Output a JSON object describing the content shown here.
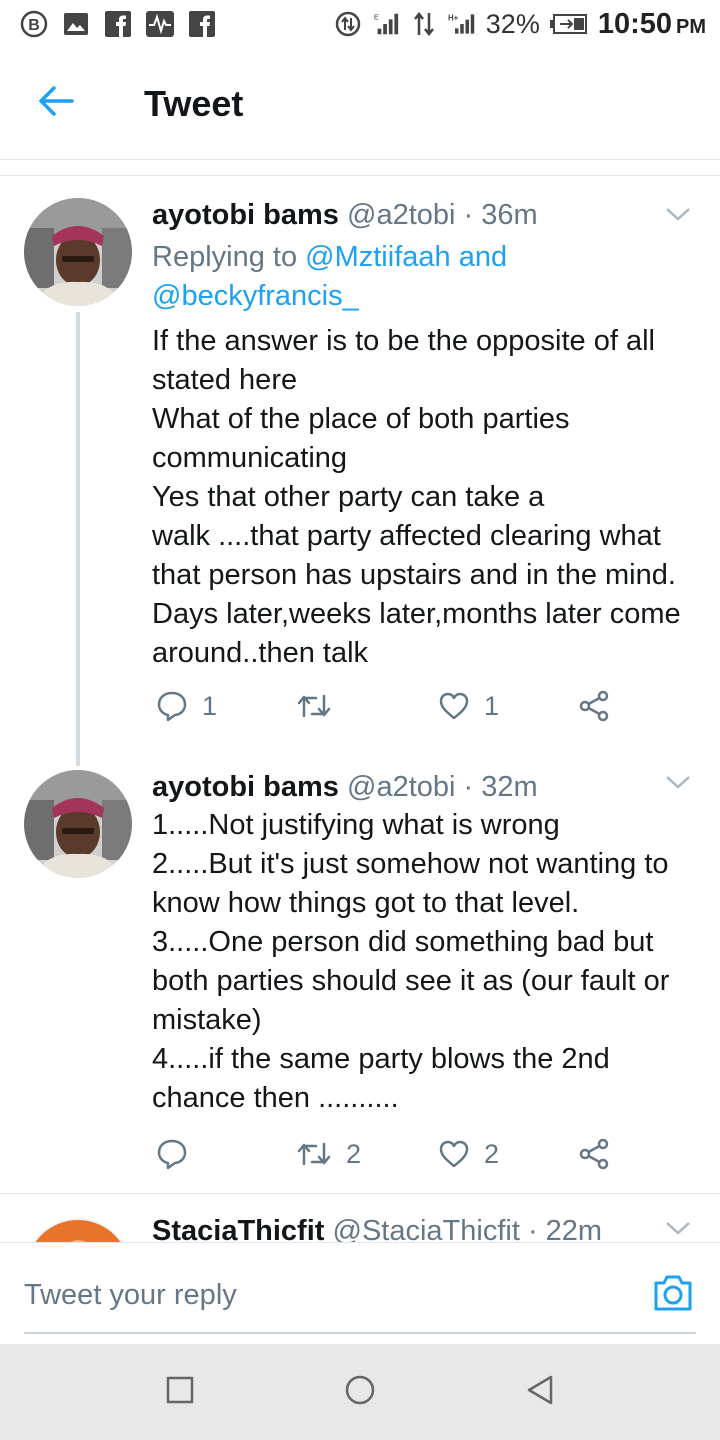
{
  "status_bar": {
    "battery": "32%",
    "time": "10:50",
    "ampm": "PM",
    "icons": [
      "b-circle-icon",
      "image-icon",
      "facebook-icon",
      "activity-icon",
      "facebook-icon",
      "data-saver-icon",
      "signal-icon",
      "data-arrows-icon",
      "signal-h-plus-icon",
      "battery-icon"
    ]
  },
  "header": {
    "title": "Tweet",
    "back_icon": "arrow-left-icon"
  },
  "tweets": [
    {
      "name": "ayotobi bams",
      "handle": "@a2tobi",
      "time": "· 36m",
      "replying_prefix": "Replying to",
      "replying_user1": "@Mztiifaah",
      "replying_and": "and",
      "replying_user2": "@beckyfrancis_",
      "text": "If the answer is to be the opposite of all\nstated here\nWhat of the place of both parties\ncommunicating\nYes that other party can take a\nwalk ....that party affected clearing what\nthat person has upstairs and in the mind.\nDays later,weeks later,months later come\naround..then talk",
      "reply_count": "1",
      "retweet_count": "",
      "like_count": "1"
    },
    {
      "name": "ayotobi bams",
      "handle": "@a2tobi",
      "time": "· 32m",
      "text": "1.....Not  justifying what is wrong\n2.....But it's just somehow not wanting to\nknow how things got to that level.\n3.....One person did something bad but\nboth parties should see it as (our fault or\nmistake)\n4.....if the same party blows the 2nd\nchance then ..........",
      "reply_count": "",
      "retweet_count": "2",
      "like_count": "2"
    },
    {
      "name": "StaciaThicfit",
      "handle": "@StaciaThicfit",
      "time": "· 22m"
    }
  ],
  "reply_bar": {
    "placeholder": "Tweet your reply",
    "camera_icon": "camera-icon"
  },
  "nav_bar": {
    "icons": [
      "recent-apps-icon",
      "home-icon",
      "back-icon"
    ]
  },
  "colors": {
    "accent": "#1da1f2",
    "text": "#14171a",
    "muted": "#657786",
    "border": "#e1e8ed"
  }
}
